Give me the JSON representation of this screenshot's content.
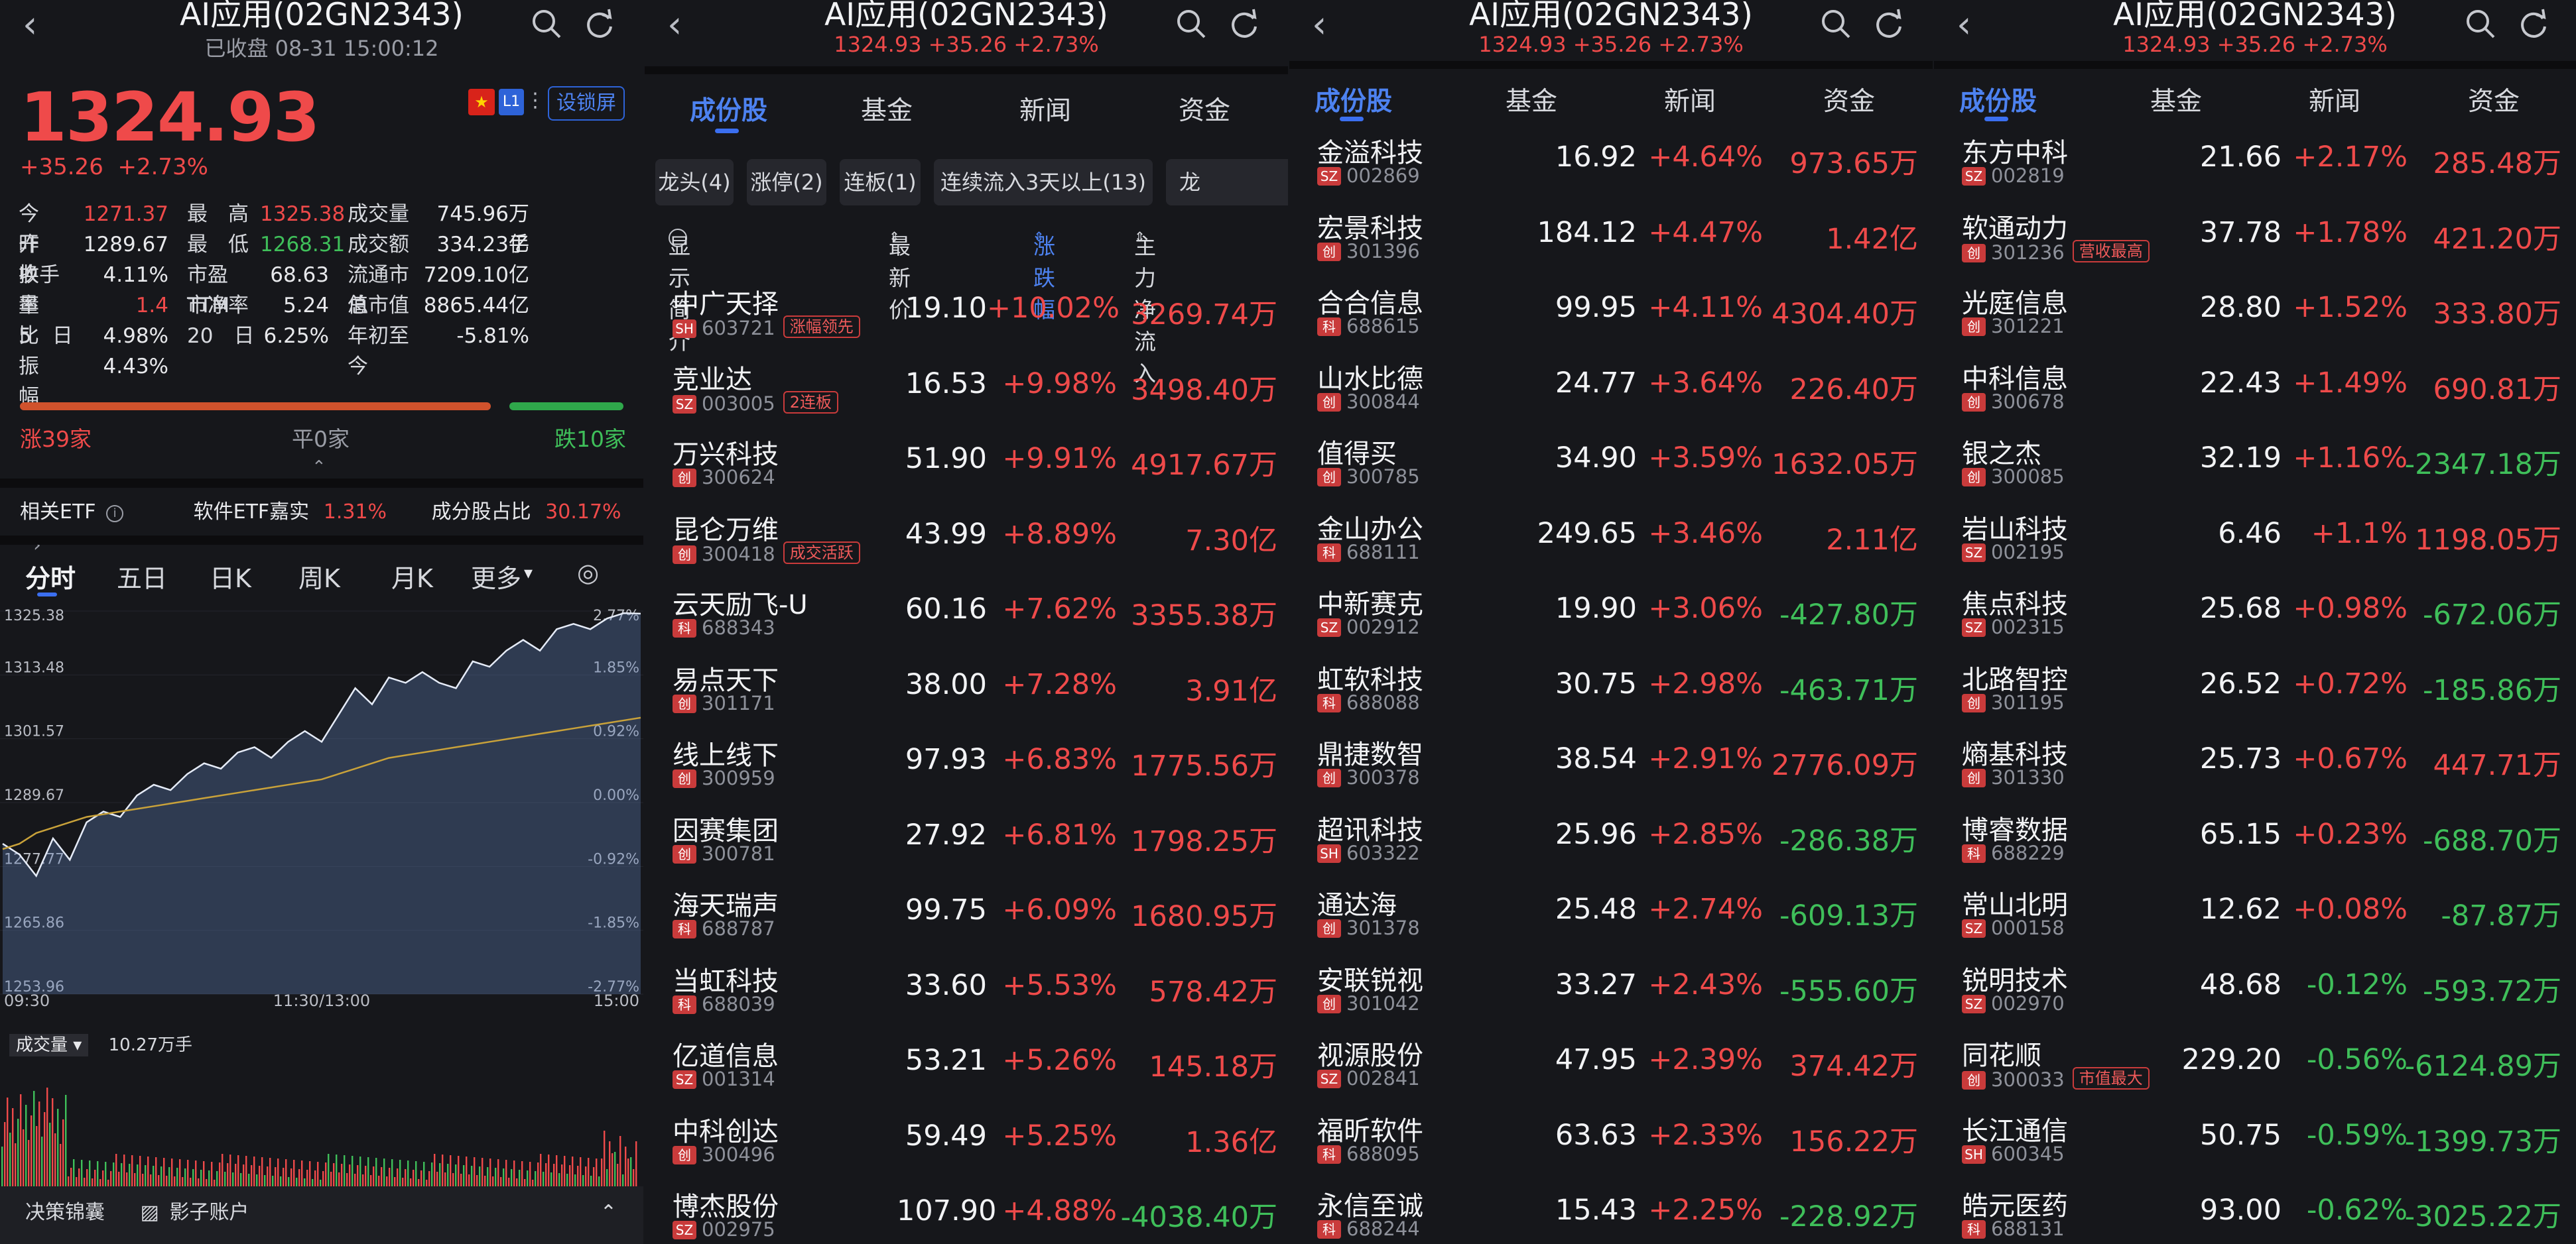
{
  "index": {
    "title": "AI应用(02GN2343)",
    "closed_status": "已收盘 08-31 15:00:12",
    "price": "1324.93",
    "change": "+35.26",
    "change_pct": "+2.73%",
    "header_change": "1324.93 +35.26 +2.73%",
    "lock_button": "设锁屏",
    "flag_label": "L1"
  },
  "stats": [
    {
      "l1": "今　开",
      "v1": "1271.37",
      "c1": "up",
      "l2": "最　高",
      "v2": "1325.38",
      "c2": "up",
      "l3": "成交量",
      "v3": "745.96万手",
      "c3": "wh"
    },
    {
      "l1": "昨　收",
      "v1": "1289.67",
      "c1": "wh",
      "l2": "最　低",
      "v2": "1268.31",
      "c2": "dn",
      "l3": "成交额",
      "v3": "334.23亿",
      "c3": "wh"
    },
    {
      "l1": "换手率",
      "v1": "4.11%",
      "c1": "wh",
      "l2": "市盈TTM",
      "v2": "68.63",
      "c2": "wh",
      "l3": "流通市值",
      "v3": "7209.10亿",
      "c3": "wh"
    },
    {
      "l1": "量　比",
      "v1": "1.4",
      "c1": "up",
      "l2": "市净率",
      "v2": "5.24",
      "c2": "wh",
      "l3": "总市值",
      "v3": "8865.44亿",
      "c3": "wh"
    },
    {
      "l1": "5　日",
      "v1": "4.98%",
      "c1": "wh",
      "l2": "20　日",
      "v2": "6.25%",
      "c2": "wh",
      "l3": "年初至今",
      "v3": "-5.81%",
      "c3": "wh"
    },
    {
      "l1": "振　幅",
      "v1": "4.43%",
      "c1": "wh",
      "l2": "",
      "v2": "",
      "c2": "wh",
      "l3": "",
      "v3": "",
      "c3": "wh"
    }
  ],
  "breadth": {
    "up": "涨39家",
    "flat": "平0家",
    "down": "跌10家",
    "up_count": 39,
    "down_count": 10
  },
  "etf": {
    "label": "相关ETF",
    "name": "软件ETF嘉实",
    "name_pct": "1.31%",
    "ratio_label": "成分股占比",
    "ratio": "30.17%"
  },
  "chart_tabs": [
    "分时",
    "五日",
    "日K",
    "周K",
    "月K",
    "更多"
  ],
  "chart_data": {
    "type": "line",
    "y_left_ticks": [
      "1325.38",
      "1313.48",
      "1301.57",
      "1289.67",
      "1277.77",
      "1265.86",
      "1253.96"
    ],
    "y_right_ticks": [
      "2.77%",
      "1.85%",
      "0.92%",
      "0.00%",
      "-0.92%",
      "-1.85%",
      "-2.77%"
    ],
    "x_ticks": [
      "09:30",
      "11:30/13:00",
      "15:00"
    ],
    "ylim": [
      1253.96,
      1325.38
    ],
    "series": [
      {
        "values": [
          1282,
          1280,
          1276,
          1283,
          1279,
          1286,
          1288,
          1287,
          1291,
          1293,
          1292,
          1295,
          1297,
          1296,
          1299,
          1300,
          1298,
          1301,
          1303,
          1301,
          1306,
          1311,
          1308,
          1313,
          1312,
          1314,
          1312,
          1311,
          1316,
          1315,
          1318,
          1320,
          1318,
          1322,
          1323,
          1322,
          1324,
          1325,
          1324.9
        ]
      },
      {
        "values": [
          1281,
          1282,
          1284,
          1285,
          1286,
          1287,
          1287.5,
          1288,
          1288.5,
          1289,
          1289.5,
          1290,
          1290.5,
          1291,
          1291.5,
          1292,
          1292.5,
          1293,
          1293.5,
          1294,
          1295,
          1296,
          1297,
          1298,
          1298.5,
          1299,
          1299.5,
          1300,
          1300.5,
          1301,
          1301.5,
          1302,
          1302.5,
          1303,
          1303.5,
          1304,
          1304.5,
          1305,
          1305.5
        ]
      }
    ],
    "volume": {
      "label": "成交量",
      "value": "10.27万手"
    }
  },
  "footer": {
    "left": "决策锦囊",
    "mid": "影子账户"
  },
  "list": {
    "tabs": [
      "成份股",
      "基金",
      "新闻",
      "资金"
    ],
    "chips": [
      "龙头(4)",
      "涨停(2)",
      "连板(1)",
      "连续流入3天以上(13)",
      "龙"
    ],
    "col_show": "显示简介",
    "col_price": "最新价",
    "col_pct": "涨跌幅",
    "col_flow": "主力净流入"
  },
  "pane2_rows": [
    {
      "name": "中广天择",
      "mkt": "SH",
      "code": "603721",
      "tag": "涨幅领先",
      "price": "19.10",
      "pct": "+10.02%",
      "flow": "3269.74万",
      "fc": "up"
    },
    {
      "name": "竞业达",
      "mkt": "SZ",
      "code": "003005",
      "tag": "2连板",
      "price": "16.53",
      "pct": "+9.98%",
      "flow": "3498.40万",
      "fc": "up"
    },
    {
      "name": "万兴科技",
      "mkt": "创",
      "code": "300624",
      "tag": "",
      "price": "51.90",
      "pct": "+9.91%",
      "flow": "4917.67万",
      "fc": "up"
    },
    {
      "name": "昆仑万维",
      "mkt": "创",
      "code": "300418",
      "tag": "成交活跃",
      "price": "43.99",
      "pct": "+8.89%",
      "flow": "7.30亿",
      "fc": "up"
    },
    {
      "name": "云天励飞-U",
      "mkt": "科",
      "code": "688343",
      "tag": "",
      "price": "60.16",
      "pct": "+7.62%",
      "flow": "3355.38万",
      "fc": "up"
    },
    {
      "name": "易点天下",
      "mkt": "创",
      "code": "301171",
      "tag": "",
      "price": "38.00",
      "pct": "+7.28%",
      "flow": "3.91亿",
      "fc": "up"
    },
    {
      "name": "线上线下",
      "mkt": "创",
      "code": "300959",
      "tag": "",
      "price": "97.93",
      "pct": "+6.83%",
      "flow": "1775.56万",
      "fc": "up"
    },
    {
      "name": "因赛集团",
      "mkt": "创",
      "code": "300781",
      "tag": "",
      "price": "27.92",
      "pct": "+6.81%",
      "flow": "1798.25万",
      "fc": "up"
    },
    {
      "name": "海天瑞声",
      "mkt": "科",
      "code": "688787",
      "tag": "",
      "price": "99.75",
      "pct": "+6.09%",
      "flow": "1680.95万",
      "fc": "up"
    },
    {
      "name": "当虹科技",
      "mkt": "科",
      "code": "688039",
      "tag": "",
      "price": "33.60",
      "pct": "+5.53%",
      "flow": "578.42万",
      "fc": "up"
    },
    {
      "name": "亿道信息",
      "mkt": "SZ",
      "code": "001314",
      "tag": "",
      "price": "53.21",
      "pct": "+5.26%",
      "flow": "145.18万",
      "fc": "up"
    },
    {
      "name": "中科创达",
      "mkt": "创",
      "code": "300496",
      "tag": "",
      "price": "59.49",
      "pct": "+5.25%",
      "flow": "1.36亿",
      "fc": "up"
    },
    {
      "name": "博杰股份",
      "mkt": "SZ",
      "code": "002975",
      "tag": "",
      "price": "107.90",
      "pct": "+4.88%",
      "flow": "-4038.40万",
      "fc": "dn"
    }
  ],
  "pane3_rows": [
    {
      "name": "金溢科技",
      "mkt": "SZ",
      "code": "002869",
      "tag": "",
      "price": "16.92",
      "pct": "+4.64%",
      "flow": "973.65万",
      "fc": "up"
    },
    {
      "name": "宏景科技",
      "mkt": "创",
      "code": "301396",
      "tag": "",
      "price": "184.12",
      "pct": "+4.47%",
      "flow": "1.42亿",
      "fc": "up"
    },
    {
      "name": "合合信息",
      "mkt": "科",
      "code": "688615",
      "tag": "",
      "price": "99.95",
      "pct": "+4.11%",
      "flow": "4304.40万",
      "fc": "up"
    },
    {
      "name": "山水比德",
      "mkt": "创",
      "code": "300844",
      "tag": "",
      "price": "24.77",
      "pct": "+3.64%",
      "flow": "226.40万",
      "fc": "up"
    },
    {
      "name": "值得买",
      "mkt": "创",
      "code": "300785",
      "tag": "",
      "price": "34.90",
      "pct": "+3.59%",
      "flow": "1632.05万",
      "fc": "up"
    },
    {
      "name": "金山办公",
      "mkt": "科",
      "code": "688111",
      "tag": "",
      "price": "249.65",
      "pct": "+3.46%",
      "flow": "2.11亿",
      "fc": "up"
    },
    {
      "name": "中新赛克",
      "mkt": "SZ",
      "code": "002912",
      "tag": "",
      "price": "19.90",
      "pct": "+3.06%",
      "flow": "-427.80万",
      "fc": "dn"
    },
    {
      "name": "虹软科技",
      "mkt": "科",
      "code": "688088",
      "tag": "",
      "price": "30.75",
      "pct": "+2.98%",
      "flow": "-463.71万",
      "fc": "dn"
    },
    {
      "name": "鼎捷数智",
      "mkt": "创",
      "code": "300378",
      "tag": "",
      "price": "38.54",
      "pct": "+2.91%",
      "flow": "2776.09万",
      "fc": "up"
    },
    {
      "name": "超讯科技",
      "mkt": "SH",
      "code": "603322",
      "tag": "",
      "price": "25.96",
      "pct": "+2.85%",
      "flow": "-286.38万",
      "fc": "dn"
    },
    {
      "name": "通达海",
      "mkt": "创",
      "code": "301378",
      "tag": "",
      "price": "25.48",
      "pct": "+2.74%",
      "flow": "-609.13万",
      "fc": "dn"
    },
    {
      "name": "安联锐视",
      "mkt": "创",
      "code": "301042",
      "tag": "",
      "price": "33.27",
      "pct": "+2.43%",
      "flow": "-555.60万",
      "fc": "dn"
    },
    {
      "name": "视源股份",
      "mkt": "SZ",
      "code": "002841",
      "tag": "",
      "price": "47.95",
      "pct": "+2.39%",
      "flow": "374.42万",
      "fc": "up"
    },
    {
      "name": "福昕软件",
      "mkt": "科",
      "code": "688095",
      "tag": "",
      "price": "63.63",
      "pct": "+2.33%",
      "flow": "156.22万",
      "fc": "up"
    },
    {
      "name": "永信至诚",
      "mkt": "科",
      "code": "688244",
      "tag": "",
      "price": "15.43",
      "pct": "+2.25%",
      "flow": "-228.92万",
      "fc": "dn"
    }
  ],
  "pane4_rows": [
    {
      "name": "东方中科",
      "mkt": "SZ",
      "code": "002819",
      "tag": "",
      "price": "21.66",
      "pct": "+2.17%",
      "flow": "285.48万",
      "fc": "up"
    },
    {
      "name": "软通动力",
      "mkt": "创",
      "code": "301236",
      "tag": "营收最高",
      "price": "37.78",
      "pct": "+1.78%",
      "flow": "421.20万",
      "fc": "up"
    },
    {
      "name": "光庭信息",
      "mkt": "创",
      "code": "301221",
      "tag": "",
      "price": "28.80",
      "pct": "+1.52%",
      "flow": "333.80万",
      "fc": "up"
    },
    {
      "name": "中科信息",
      "mkt": "创",
      "code": "300678",
      "tag": "",
      "price": "22.43",
      "pct": "+1.49%",
      "flow": "690.81万",
      "fc": "up"
    },
    {
      "name": "银之杰",
      "mkt": "创",
      "code": "300085",
      "tag": "",
      "price": "32.19",
      "pct": "+1.16%",
      "flow": "-2347.18万",
      "fc": "dn"
    },
    {
      "name": "岩山科技",
      "mkt": "SZ",
      "code": "002195",
      "tag": "",
      "price": "6.46",
      "pct": "+1.1%",
      "flow": "1198.05万",
      "fc": "up"
    },
    {
      "name": "焦点科技",
      "mkt": "SZ",
      "code": "002315",
      "tag": "",
      "price": "25.68",
      "pct": "+0.98%",
      "flow": "-672.06万",
      "fc": "dn"
    },
    {
      "name": "北路智控",
      "mkt": "创",
      "code": "301195",
      "tag": "",
      "price": "26.52",
      "pct": "+0.72%",
      "flow": "-185.86万",
      "fc": "dn"
    },
    {
      "name": "熵基科技",
      "mkt": "创",
      "code": "301330",
      "tag": "",
      "price": "25.73",
      "pct": "+0.67%",
      "flow": "447.71万",
      "fc": "up"
    },
    {
      "name": "博睿数据",
      "mkt": "科",
      "code": "688229",
      "tag": "",
      "price": "65.15",
      "pct": "+0.23%",
      "flow": "-688.70万",
      "fc": "dn"
    },
    {
      "name": "常山北明",
      "mkt": "SZ",
      "code": "000158",
      "tag": "",
      "price": "12.62",
      "pct": "+0.08%",
      "flow": "-87.87万",
      "fc": "dn"
    },
    {
      "name": "锐明技术",
      "mkt": "SZ",
      "code": "002970",
      "tag": "",
      "price": "48.68",
      "pct": "-0.12%",
      "flow": "-593.72万",
      "fc": "dn"
    },
    {
      "name": "同花顺",
      "mkt": "创",
      "code": "300033",
      "tag": "市值最大",
      "price": "229.20",
      "pct": "-0.56%",
      "flow": "-6124.89万",
      "fc": "dn"
    },
    {
      "name": "长江通信",
      "mkt": "SH",
      "code": "600345",
      "tag": "",
      "price": "50.75",
      "pct": "-0.59%",
      "flow": "-1399.73万",
      "fc": "dn"
    },
    {
      "name": "皓元医药",
      "mkt": "科",
      "code": "688131",
      "tag": "",
      "price": "93.00",
      "pct": "-0.62%",
      "flow": "-3025.22万",
      "fc": "dn"
    }
  ]
}
